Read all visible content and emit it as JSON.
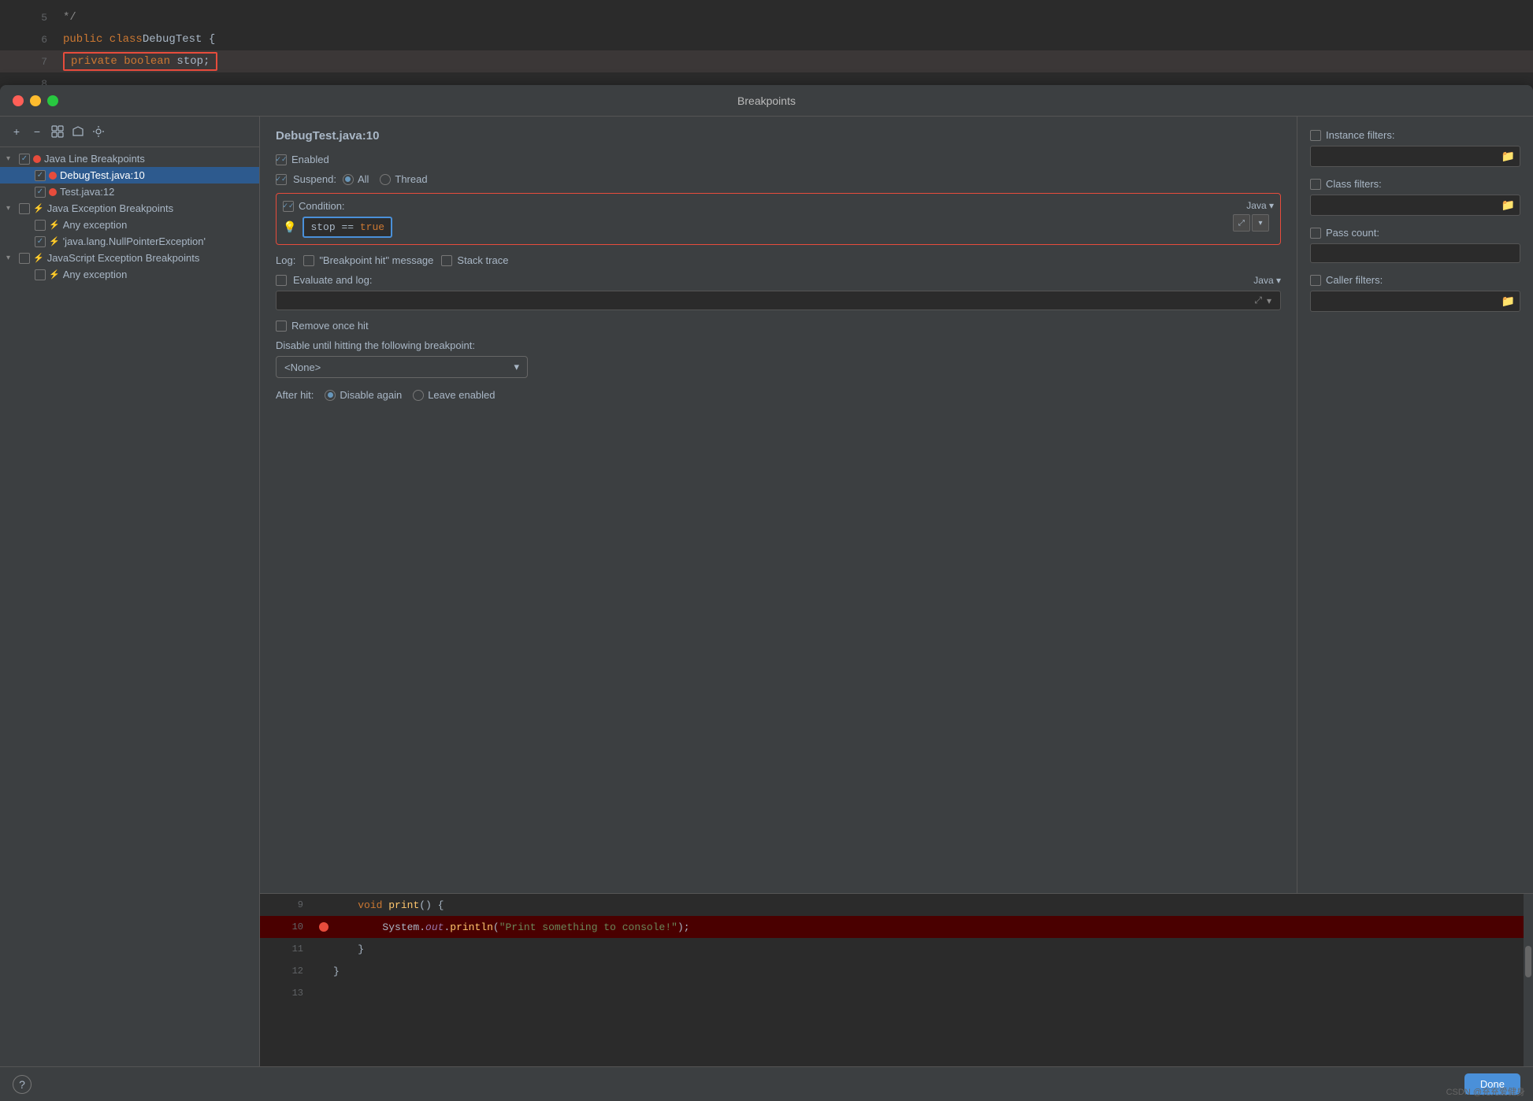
{
  "dialog": {
    "title": "Breakpoints"
  },
  "toolbar": {
    "add_label": "+",
    "remove_label": "−",
    "group_label": "⊞",
    "export_label": "↑",
    "help_label": "⋯"
  },
  "tree": {
    "items": [
      {
        "id": "java-line-group",
        "label": "Java Line Breakpoints",
        "level": 0,
        "arrow": "▾",
        "checked": true,
        "dot": false,
        "lightning": false
      },
      {
        "id": "debugtest-10",
        "label": "DebugTest.java:10",
        "level": 1,
        "arrow": "",
        "checked": true,
        "dot": true,
        "lightning": false,
        "selected": true
      },
      {
        "id": "test-12",
        "label": "Test.java:12",
        "level": 1,
        "arrow": "",
        "checked": true,
        "dot": true,
        "lightning": false
      },
      {
        "id": "java-exception-group",
        "label": "Java Exception Breakpoints",
        "level": 0,
        "arrow": "▾",
        "checked": false,
        "dot": false,
        "lightning": true
      },
      {
        "id": "any-exception-java",
        "label": "Any exception",
        "level": 1,
        "arrow": "",
        "checked": false,
        "dot": false,
        "lightning": true
      },
      {
        "id": "nullpointer",
        "label": "'java.lang.NullPointerException'",
        "level": 1,
        "arrow": "",
        "checked": true,
        "dot": false,
        "lightning": true
      },
      {
        "id": "js-exception-group",
        "label": "JavaScript Exception Breakpoints",
        "level": 0,
        "arrow": "▾",
        "checked": false,
        "dot": false,
        "lightning": true
      },
      {
        "id": "any-exception-js",
        "label": "Any exception",
        "level": 1,
        "arrow": "",
        "checked": false,
        "dot": false,
        "lightning": true
      }
    ]
  },
  "detail": {
    "title": "DebugTest.java:10",
    "enabled_label": "Enabled",
    "enabled_checked": true,
    "suspend_label": "Suspend:",
    "suspend_all": "All",
    "suspend_thread": "Thread",
    "suspend_all_selected": true,
    "condition_label": "Condition:",
    "condition_checked": true,
    "condition_code": "stop == true",
    "java_label": "Java ▾",
    "log_label": "Log:",
    "log_message_label": "\"Breakpoint hit\" message",
    "log_stack_label": "Stack trace",
    "log_message_checked": false,
    "log_stack_checked": false,
    "eval_label": "Evaluate and log:",
    "eval_checked": false,
    "eval_java_label": "Java ▾",
    "remove_label": "Remove once hit",
    "remove_checked": false,
    "disable_label": "Disable until hitting the following breakpoint:",
    "disable_none": "<None>",
    "after_hit_label": "After hit:",
    "after_disable_label": "Disable again",
    "after_leave_label": "Leave enabled",
    "after_disable_selected": true
  },
  "filters": {
    "instance_label": "Instance filters:",
    "class_label": "Class filters:",
    "pass_label": "Pass count:",
    "caller_label": "Caller filters:"
  },
  "code": {
    "lines": [
      {
        "num": "9",
        "active": false,
        "text": "    void print() {",
        "has_bp": false
      },
      {
        "num": "10",
        "active": true,
        "text": "        System.out.println(\"Print something to console!\");",
        "has_bp": true
      },
      {
        "num": "11",
        "active": false,
        "text": "    }",
        "has_bp": false
      },
      {
        "num": "12",
        "active": false,
        "text": "}",
        "has_bp": false
      },
      {
        "num": "13",
        "active": false,
        "text": "",
        "has_bp": false
      }
    ]
  },
  "bg_code": {
    "lines": [
      {
        "num": "5",
        "text": "*/"
      },
      {
        "num": "6",
        "text": "public class DebugTest {"
      },
      {
        "num": "7",
        "text": "private boolean stop;",
        "highlight": true
      },
      {
        "num": "8",
        "text": ""
      }
    ]
  },
  "bottom": {
    "help_label": "?",
    "done_label": "Done",
    "watermark": "CSDN @充充爱健身"
  }
}
